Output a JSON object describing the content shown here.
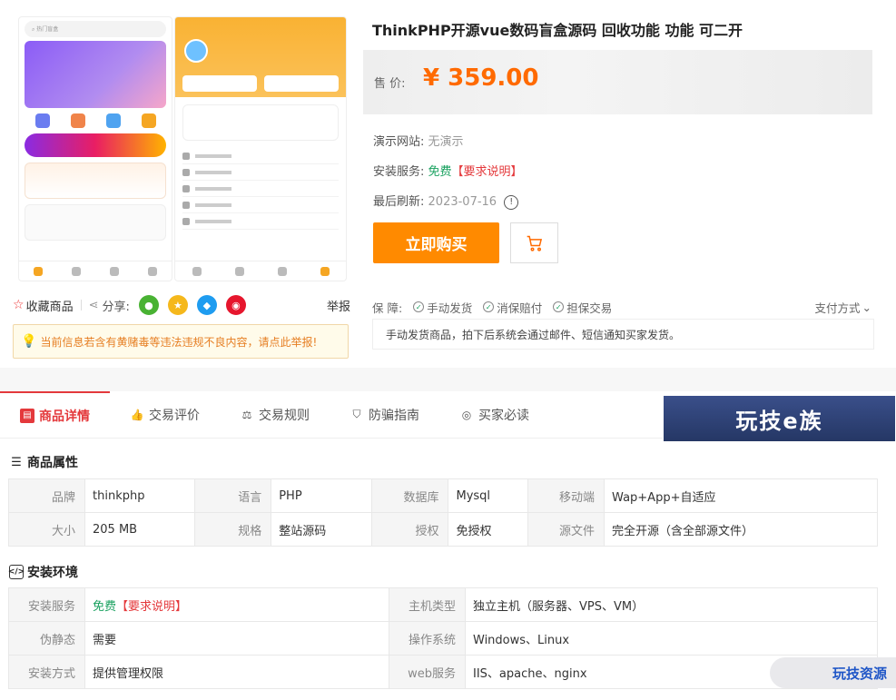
{
  "gallery": {
    "search_placeholder": "热门盲盒"
  },
  "share": {
    "favorite_label": "收藏商品",
    "share_label": "分享:",
    "report_label": "举报"
  },
  "warning": {
    "text": "当前信息若含有黄赌毒等违法违规不良内容，请点此举报!"
  },
  "product": {
    "title": "ThinkPHP开源vue数码盲盒源码 回收功能 功能 可二开",
    "price_label": "售 价:",
    "price": "¥ 359.00",
    "demo_label": "演示网站:",
    "demo_value": "无演示",
    "install_label": "安装服务:",
    "install_free": "免费",
    "install_req": "【要求说明】",
    "refresh_label": "最后刷新:",
    "refresh_value": "2023-07-16",
    "buy_label": "立即购买",
    "guarantee_label": "保 障:",
    "guarantees": [
      "手动发货",
      "消保赔付",
      "担保交易"
    ],
    "payment_label": "支付方式",
    "note": "手动发货商品，拍下后系统会通过邮件、短信通知买家发货。"
  },
  "tabs": [
    "商品详情",
    "交易评价",
    "交易规则",
    "防骗指南",
    "买家必读"
  ],
  "brand_banner": "玩技e族",
  "attributes": {
    "title": "商品属性",
    "rows": [
      [
        [
          "品牌",
          "thinkphp"
        ],
        [
          "语言",
          "PHP"
        ],
        [
          "数据库",
          "Mysql"
        ],
        [
          "移动端",
          "Wap+App+自适应"
        ]
      ],
      [
        [
          "大小",
          "205 MB"
        ],
        [
          "规格",
          "整站源码"
        ],
        [
          "授权",
          "免授权"
        ],
        [
          "源文件",
          "完全开源（含全部源文件）"
        ]
      ]
    ]
  },
  "environment": {
    "title": "安装环境",
    "install_key": "安装服务",
    "install_free": "免费",
    "install_req": "【要求说明】",
    "host_key": "主机类型",
    "host_val": "独立主机（服务器、VPS、VM）",
    "rewrite_key": "伪静态",
    "rewrite_val": "需要",
    "os_key": "操作系统",
    "os_val": "Windows、Linux",
    "method_key": "安装方式",
    "method_val": "提供管理权限",
    "web_key": "web服务",
    "web_val": "IIS、apache、nginx"
  },
  "watermark": "玩技资源",
  "colors": {
    "accent": "#ff8a00",
    "price": "#ff6a00",
    "red": "#e4393c",
    "green": "#19a15f"
  }
}
